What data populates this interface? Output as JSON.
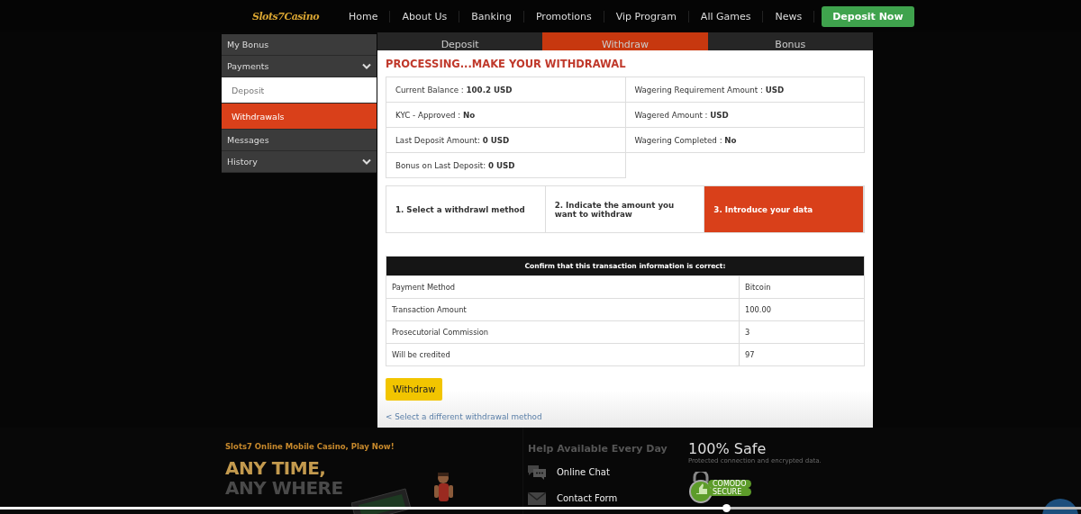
{
  "header": {
    "logo": "Slots7Casino",
    "nav": [
      "Home",
      "About Us",
      "Banking",
      "Promotions",
      "Vip Program",
      "All Games",
      "News"
    ],
    "cta": "Deposit Now"
  },
  "sidebar": {
    "items": [
      {
        "label": "My Bonus",
        "kind": "link",
        "selected": false
      },
      {
        "label": "Payments",
        "kind": "group",
        "selected": false,
        "children": [
          {
            "label": "Deposit",
            "selected": false
          },
          {
            "label": "Withdrawals",
            "selected": true
          }
        ]
      },
      {
        "label": "Messages",
        "kind": "link",
        "selected": false
      },
      {
        "label": "History",
        "kind": "group",
        "selected": false
      }
    ]
  },
  "tabs": [
    {
      "label": "Deposit",
      "selected": false
    },
    {
      "label": "Withdraw",
      "selected": true
    },
    {
      "label": "Bonus",
      "selected": false
    }
  ],
  "panel": {
    "title": "PROCESSING...MAKE YOUR WITHDRAWAL",
    "info": [
      "Current Balance : **100.2 USD**",
      "Wagering Requirement Amount : **USD**",
      "KYC - Approved : **No**",
      "Wagered Amount : **USD**",
      "Last Deposit Amount: **0 USD**",
      "Wagering Completed : **No**",
      "Bonus on Last Deposit: **0 USD**"
    ],
    "steps": [
      {
        "label": "1. Select a withdrawl method",
        "selected": false
      },
      {
        "label": "2. Indicate the amount you want to withdraw",
        "selected": false
      },
      {
        "label": "3. Introduce your data",
        "selected": true
      }
    ],
    "confirm": {
      "heading": "Confirm that this transaction information is correct:",
      "rows": [
        [
          "Payment Method",
          "Bitcoin"
        ],
        [
          "Transaction Amount",
          "100.00"
        ],
        [
          "Prosecutorial Commission",
          "3"
        ],
        [
          "Will be credited",
          "97"
        ]
      ]
    },
    "button": "Withdraw",
    "back_link": "< Select a different withdrawal method"
  },
  "footer": {
    "promo": "Slots7 Online Mobile Casino, Play Now!",
    "headline_1": "ANY TIME,",
    "headline_2": "ANY WHERE",
    "app_picture": {
      "kind": "picture"
    },
    "help_title": "Help Available Every Day",
    "help_links": [
      {
        "kind": "chat",
        "label": "Online Chat"
      },
      {
        "kind": "mail",
        "label": "Contact Form"
      }
    ],
    "safe_title": "100% Safe",
    "safe_note": "Protected connection and encrypted data.",
    "badge": [
      "COMODO",
      "SECURE"
    ]
  },
  "video_player": {
    "level": 0.672
  }
}
